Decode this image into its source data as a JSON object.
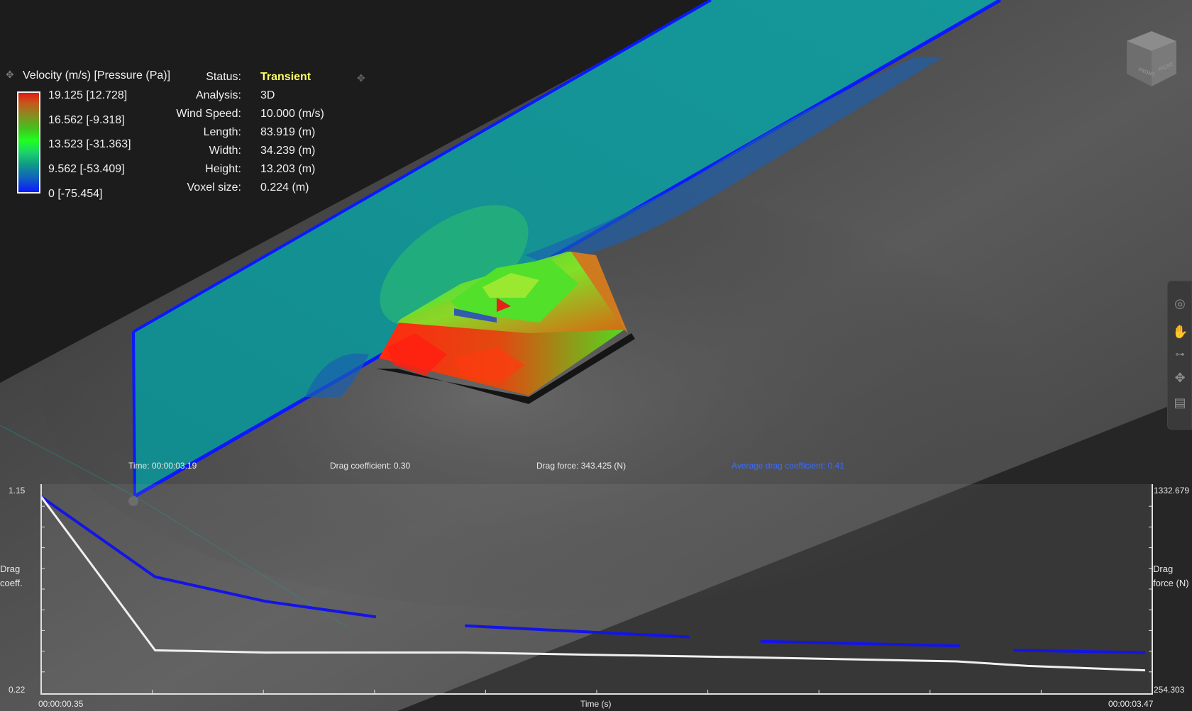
{
  "legend": {
    "title": "Velocity (m/s) [Pressure (Pa)]",
    "ticks": [
      "19.125 [12.728]",
      "16.562 [-9.318]",
      "13.523 [-31.363]",
      "9.562 [-53.409]",
      "0 [-75.454]"
    ]
  },
  "info": {
    "rows": [
      {
        "label": "Status:",
        "value": "Transient"
      },
      {
        "label": "Analysis:",
        "value": "3D"
      },
      {
        "label": "Wind Speed:",
        "value": "10.000 (m/s)"
      },
      {
        "label": "Length:",
        "value": "83.919 (m)"
      },
      {
        "label": "Width:",
        "value": "34.239 (m)"
      },
      {
        "label": "Height:",
        "value": "13.203 (m)"
      },
      {
        "label": "Voxel size:",
        "value": "0.224 (m)"
      }
    ]
  },
  "stats": {
    "time": "Time: 00:00:03.19",
    "drag_coefficient": "Drag coefficient: 0.30",
    "drag_force": "Drag force: 343.425 (N)",
    "avg_drag_coefficient": "Average drag coefficient: 0.41"
  },
  "plot": {
    "left_axis_top": "1.15",
    "left_axis_bottom": "0.22",
    "left_axis_label": "Drag coeff.",
    "right_axis_top": "1332.679",
    "right_axis_bottom": "254.303",
    "right_axis_label": "Drag force (N)",
    "x_start": "00:00:00.35",
    "x_end": "00:00:03.47",
    "x_label": "Time (s)"
  },
  "chart_data": {
    "type": "line",
    "xlabel": "Time (s)",
    "ylabel": "Drag coeff.",
    "y2label": "Drag force (N)",
    "xlim": [
      "00:00:00.35",
      "00:00:03.47"
    ],
    "ylim": [
      0.22,
      1.15
    ],
    "y2lim": [
      254.303,
      1332.679
    ],
    "series": [
      {
        "color": "#1414e6",
        "segments": [
          [
            [
              0.35,
              1.1
            ],
            [
              0.67,
              0.74
            ],
            [
              0.98,
              0.63
            ],
            [
              1.29,
              0.56
            ]
          ],
          [
            [
              1.54,
              0.52
            ],
            [
              2.17,
              0.47
            ]
          ],
          [
            [
              2.37,
              0.45
            ],
            [
              2.93,
              0.43
            ]
          ],
          [
            [
              3.08,
              0.41
            ],
            [
              3.45,
              0.4
            ]
          ]
        ]
      },
      {
        "color": "#f0f0f0",
        "points": [
          [
            0.35,
            1.1
          ],
          [
            0.67,
            0.41
          ],
          [
            0.98,
            0.4
          ],
          [
            1.29,
            0.4
          ],
          [
            1.54,
            0.4
          ],
          [
            1.89,
            0.39
          ],
          [
            2.28,
            0.38
          ],
          [
            2.92,
            0.36
          ],
          [
            3.12,
            0.34
          ],
          [
            3.45,
            0.32
          ]
        ]
      }
    ]
  },
  "colors": {
    "background": "#262626",
    "plane": "#138f8f",
    "plane_edge": "#0b18ff",
    "status_highlight": "#ffff66",
    "avg_text": "#3a6cff"
  }
}
